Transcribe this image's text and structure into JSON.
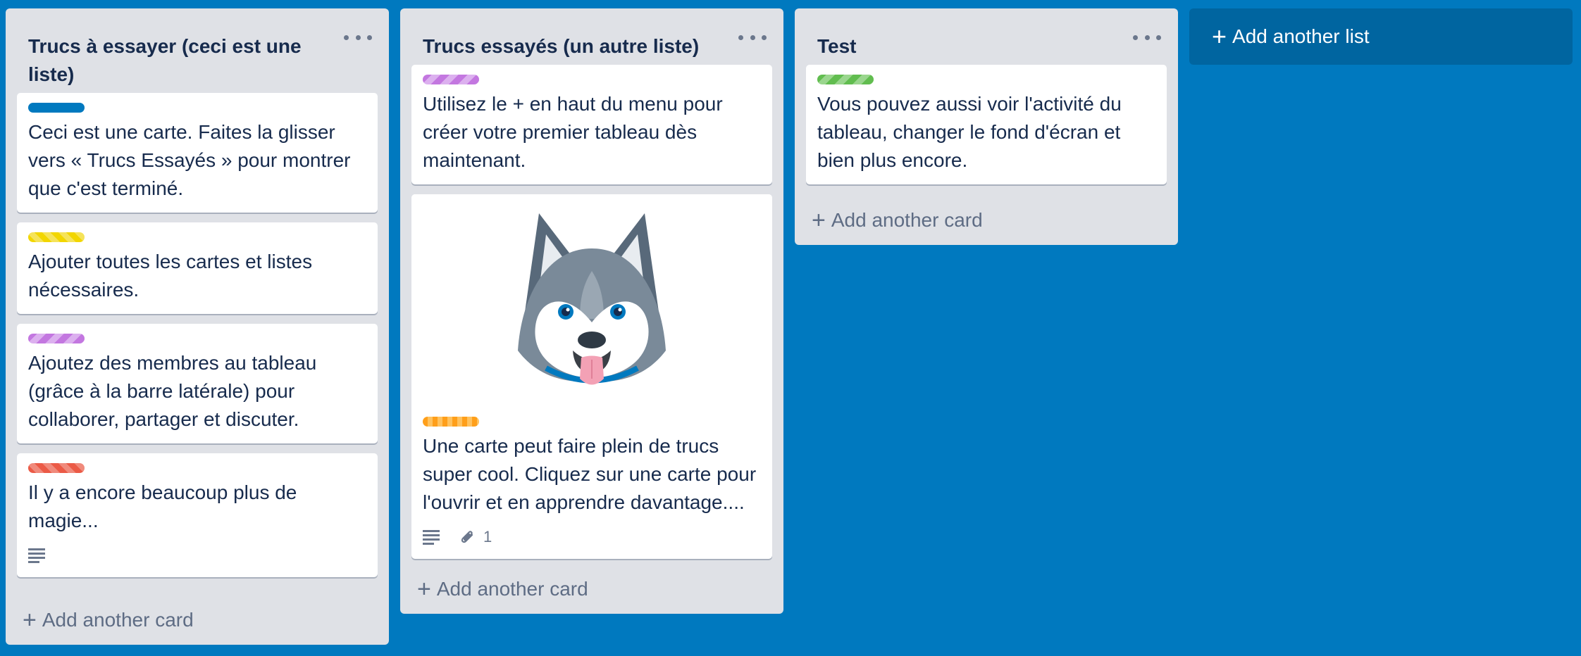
{
  "lists": [
    {
      "title": "Trucs à essayer (ceci est une liste)",
      "cards": [
        {
          "label_color": "blue",
          "text": "Ceci est une carte. Faites la glisser vers « Trucs Essayés » pour montrer que c'est terminé."
        },
        {
          "label_color": "yellow",
          "text": "Ajouter toutes les cartes et listes nécessaires."
        },
        {
          "label_color": "purple",
          "text": "Ajoutez des membres au tableau (grâce à la barre latérale) pour collaborer, partager et discuter."
        },
        {
          "label_color": "red",
          "text": "Il y a encore beaucoup plus de magie...",
          "badges": {
            "description_icon": "description-icon"
          }
        }
      ],
      "add_card_label": "Add another card"
    },
    {
      "title": "Trucs essayés (un autre liste)",
      "cards": [
        {
          "label_color": "purple",
          "text": "Utilisez le + en haut du menu pour créer votre premier tableau dès maintenant."
        },
        {
          "cover": "husky-illustration",
          "label_color": "orange",
          "text": "Une carte peut faire plein de trucs super cool. Cliquez sur une carte pour l'ouvrir et en apprendre davantage....",
          "badges": {
            "description_icon": "description-icon",
            "attachment_icon": "paperclip-icon",
            "attachment_count": "1"
          }
        }
      ],
      "add_card_label": "Add another card"
    },
    {
      "title": "Test",
      "cards": [
        {
          "label_color": "green",
          "text": "Vous pouvez aussi voir l'activité du tableau, changer le fond d'écran et bien plus encore."
        }
      ],
      "add_card_label": "Add another card"
    }
  ],
  "add_list_label": "Add another list",
  "colors": {
    "board_background": "#0079bf",
    "list_background": "#dfe1e6",
    "label_blue": "#0079bf",
    "label_yellow": "#f2d600",
    "label_purple": "#c377e0",
    "label_red": "#eb5a46",
    "label_orange": "#ff9f1a",
    "label_green": "#61bd4f"
  }
}
